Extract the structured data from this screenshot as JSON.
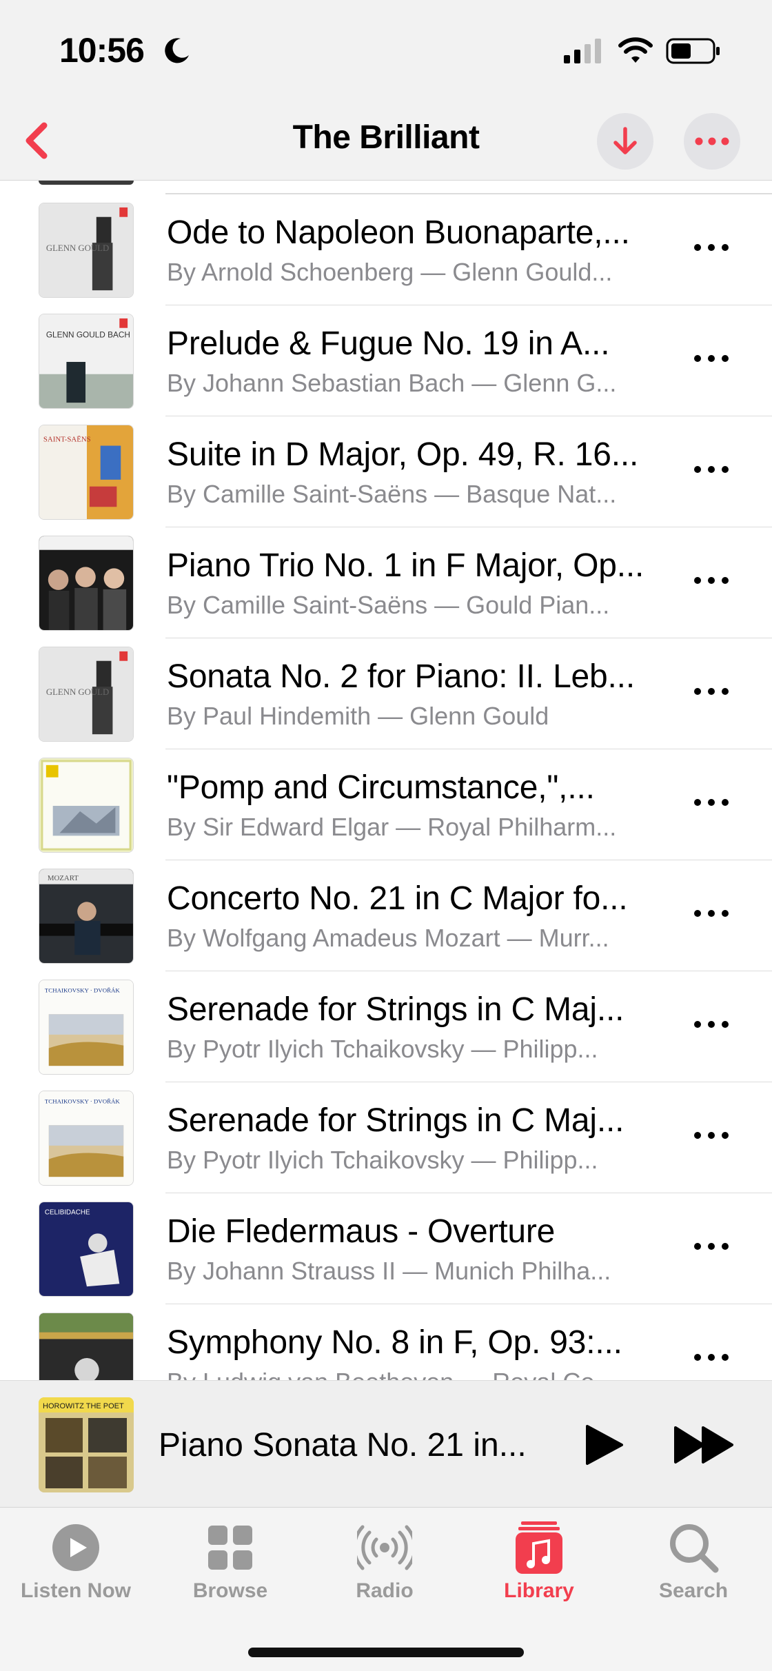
{
  "status": {
    "time": "10:56"
  },
  "header": {
    "title": "The Brilliant"
  },
  "colors": {
    "accent": "#f23e4e",
    "secondary_text": "#8a8a8e"
  },
  "songs": [
    {
      "title": "Ode to Napoleon Buonaparte,...",
      "subtitle": "By Arnold Schoenberg — Glenn Gould...",
      "art_text": "GLENN GOULD"
    },
    {
      "title": "Prelude & Fugue No. 19 in A...",
      "subtitle": "By Johann Sebastian Bach — Glenn G...",
      "art_text": "GLENN GOULD BACH"
    },
    {
      "title": "Suite in D Major, Op. 49, R. 16...",
      "subtitle": "By Camille Saint-Saëns — Basque Nat...",
      "art_text": "SAINT-SAËNS"
    },
    {
      "title": "Piano Trio No. 1 in F Major, Op...",
      "subtitle": "By Camille Saint-Saëns — Gould Pian...",
      "art_text": ""
    },
    {
      "title": "Sonata No. 2 for Piano: II. Leb...",
      "subtitle": "By Paul Hindemith — Glenn Gould",
      "art_text": "GLENN GOULD"
    },
    {
      "title": "\"Pomp and Circumstance,\",...",
      "subtitle": "By Sir Edward Elgar — Royal Philharm...",
      "art_text": ""
    },
    {
      "title": "Concerto No. 21 in C Major fo...",
      "subtitle": "By Wolfgang Amadeus Mozart — Murr...",
      "art_text": "MOZART"
    },
    {
      "title": "Serenade for Strings in C Maj...",
      "subtitle": "By Pyotr Ilyich Tchaikovsky — Philipp...",
      "art_text": "TCHAIKOVSKY · DVOŘÁK"
    },
    {
      "title": "Serenade for Strings in C Maj...",
      "subtitle": "By Pyotr Ilyich Tchaikovsky — Philipp...",
      "art_text": "TCHAIKOVSKY · DVOŘÁK"
    },
    {
      "title": "Die Fledermaus - Overture",
      "subtitle": "By Johann Strauss II — Munich Philha...",
      "art_text": "CELIBIDACHE"
    },
    {
      "title": "Symphony No. 8 in F, Op. 93:...",
      "subtitle": "By Ludwig van Beethoven — Royal Co...",
      "art_text": ""
    }
  ],
  "now_playing": {
    "title": "Piano Sonata No. 21 in...",
    "art_text": "HOROWITZ THE POET"
  },
  "tabs": [
    {
      "label": "Listen Now",
      "icon": "play-circle-icon",
      "active": false
    },
    {
      "label": "Browse",
      "icon": "grid-icon",
      "active": false
    },
    {
      "label": "Radio",
      "icon": "radio-waves-icon",
      "active": false
    },
    {
      "label": "Library",
      "icon": "music-note-icon",
      "active": true
    },
    {
      "label": "Search",
      "icon": "magnifier-icon",
      "active": false
    }
  ]
}
